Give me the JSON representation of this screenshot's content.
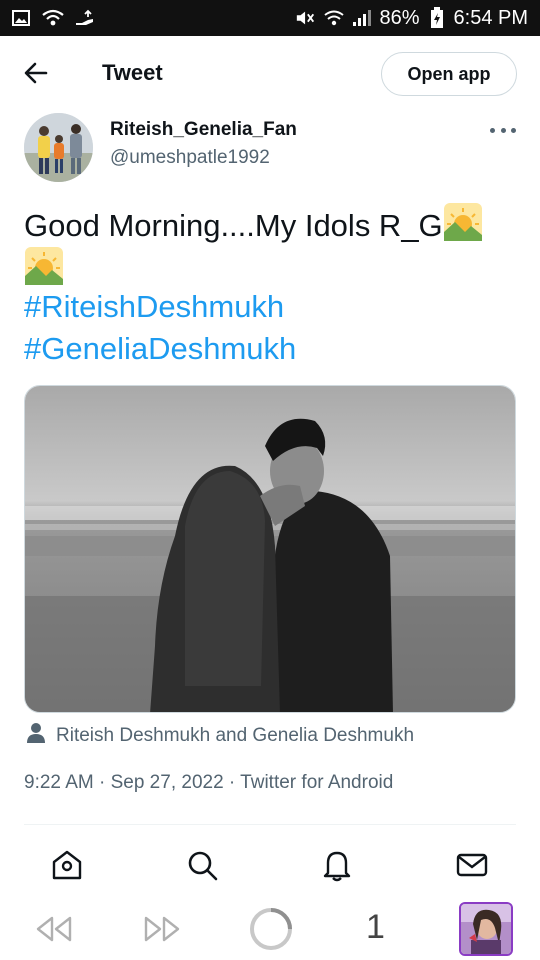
{
  "status_bar": {
    "battery_percent": "86%",
    "time": "6:54 PM"
  },
  "header": {
    "title": "Tweet",
    "open_app_label": "Open app"
  },
  "author": {
    "name": "Riteish_Genelia_Fan",
    "handle": "@umeshpatle1992"
  },
  "tweet": {
    "text": "Good Morning....My Idols R_G",
    "hashtags": [
      "#RiteishDeshmukh",
      "#GeneliaDeshmukh"
    ],
    "tagged_people": "Riteish Deshmukh and Genelia Deshmukh",
    "meta": "9:22 AM · Sep 27, 2022 · Twitter for Android"
  },
  "browser": {
    "tab_count": "1"
  },
  "colors": {
    "link_blue": "#1d9bf0",
    "secondary_text": "#536471",
    "border": "#cfd9de"
  },
  "icons": [
    "gallery-icon",
    "wifi-icon",
    "hand-icon",
    "mute-icon",
    "signal-icon",
    "battery-icon",
    "back-arrow-icon",
    "more-icon",
    "sunrise-emoji",
    "person-icon",
    "home-icon",
    "search-icon",
    "bell-icon",
    "mail-icon",
    "rewind-icon",
    "forward-icon",
    "loading-icon"
  ]
}
